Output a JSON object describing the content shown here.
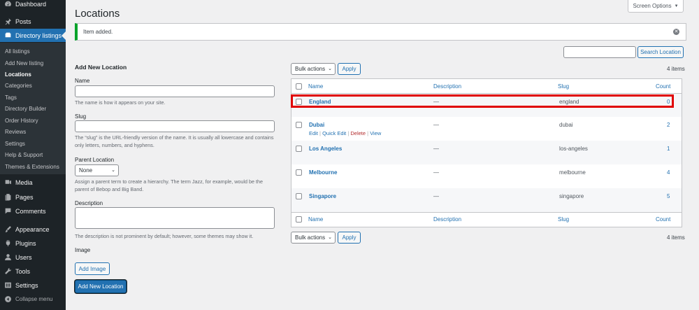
{
  "sidebar": {
    "dashboard": "Dashboard",
    "posts": "Posts",
    "directory": "Directory listings",
    "submenu": [
      "All listings",
      "Add New listing",
      "Locations",
      "Categories",
      "Tags",
      "Directory Builder",
      "Order History",
      "Reviews",
      "Settings",
      "Help & Support",
      "Themes & Extensions"
    ],
    "media": "Media",
    "pages": "Pages",
    "comments": "Comments",
    "appearance": "Appearance",
    "plugins": "Plugins",
    "users": "Users",
    "tools": "Tools",
    "settings": "Settings",
    "collapse": "Collapse menu"
  },
  "header": {
    "title": "Locations",
    "screen_options": "Screen Options"
  },
  "notice": {
    "text": "Item added."
  },
  "search": {
    "button": "Search Location"
  },
  "form": {
    "title": "Add New Location",
    "name_label": "Name",
    "name_help": "The name is how it appears on your site.",
    "slug_label": "Slug",
    "slug_help": "The “slug” is the URL-friendly version of the name. It is usually all lowercase and contains only letters, numbers, and hyphens.",
    "parent_label": "Parent Location",
    "parent_value": "None",
    "parent_help": "Assign a parent term to create a hierarchy. The term Jazz, for example, would be the parent of Bebop and Big Band.",
    "description_label": "Description",
    "description_help": "The description is not prominent by default; however, some themes may show it.",
    "image_label": "Image",
    "add_image": "Add Image",
    "submit": "Add New Location"
  },
  "table": {
    "bulk_actions": "Bulk actions",
    "apply": "Apply",
    "items_count": "4 items",
    "columns": {
      "name": "Name",
      "description": "Description",
      "slug": "Slug",
      "count": "Count"
    },
    "rows": [
      {
        "name": "England",
        "description": "—",
        "slug": "england",
        "count": "0"
      },
      {
        "name": "Dubai",
        "description": "—",
        "slug": "dubai",
        "count": "2"
      },
      {
        "name": "Los Angeles",
        "description": "—",
        "slug": "los-angeles",
        "count": "1"
      },
      {
        "name": "Melbourne",
        "description": "—",
        "slug": "melbourne",
        "count": "4"
      },
      {
        "name": "Singapore",
        "description": "—",
        "slug": "singapore",
        "count": "5"
      }
    ],
    "row_actions": {
      "edit": "Edit",
      "quick_edit": "Quick Edit",
      "delete": "Delete",
      "view": "View"
    }
  }
}
